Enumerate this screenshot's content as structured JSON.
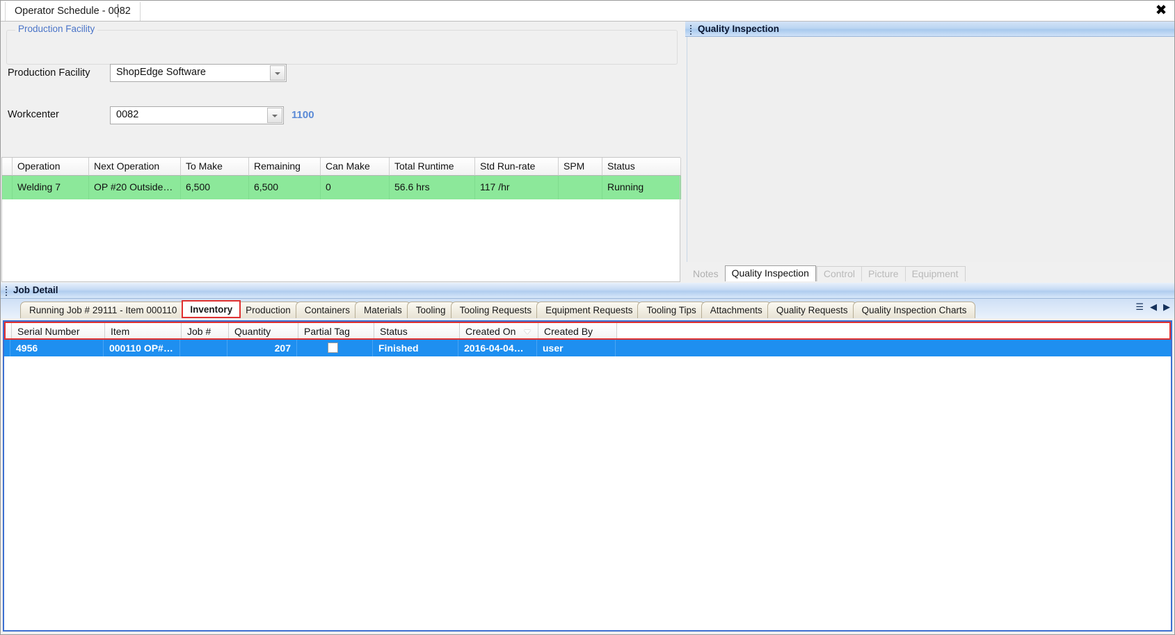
{
  "window": {
    "mdi_tab_label": "Operator Schedule - 0082",
    "close_label": "✖"
  },
  "form": {
    "groupbox_title": "Production Facility",
    "production_facility_label": "Production Facility",
    "production_facility_value": "ShopEdge Software",
    "workcenter_label": "Workcenter",
    "workcenter_value": "0082",
    "workcenter_code": "1100"
  },
  "operations_grid": {
    "columns": [
      "Operation",
      "Next Operation",
      "To Make",
      "Remaining",
      "Can Make",
      "Total Runtime",
      "Std Run-rate",
      "SPM",
      "Status"
    ],
    "rows": [
      {
        "operation": "Welding 7",
        "next_operation": "OP  #20  Outside…",
        "to_make": "6,500",
        "remaining": "6,500",
        "can_make": "0",
        "total_runtime": "56.6 hrs",
        "std_run_rate": "117 /hr",
        "spm": "",
        "status": "Running"
      }
    ],
    "row_highlight_color": "#8ce89a",
    "scroll_left_arrow": "‹",
    "scroll_right_arrow": "›"
  },
  "quality_panel": {
    "title": "Quality Inspection",
    "tabs": [
      {
        "label": "Notes",
        "state": "muted"
      },
      {
        "label": "Quality Inspection",
        "state": "active"
      },
      {
        "label": "Control",
        "state": "dim"
      },
      {
        "label": "Picture",
        "state": "dim"
      },
      {
        "label": "Equipment",
        "state": "dim"
      }
    ]
  },
  "job_detail": {
    "title": "Job Detail",
    "tabs": [
      {
        "label": "Running Job # 29111 - Item 000110",
        "active": false
      },
      {
        "label": "Inventory",
        "active": true
      },
      {
        "label": "Production",
        "active": false
      },
      {
        "label": "Containers",
        "active": false
      },
      {
        "label": "Materials",
        "active": false
      },
      {
        "label": "Tooling",
        "active": false
      },
      {
        "label": "Tooling Requests",
        "active": false
      },
      {
        "label": "Equipment Requests",
        "active": false
      },
      {
        "label": "Tooling Tips",
        "active": false
      },
      {
        "label": "Attachments",
        "active": false
      },
      {
        "label": "Quality Requests",
        "active": false
      },
      {
        "label": "Quality Inspection Charts",
        "active": false
      }
    ],
    "tab_nav": {
      "menu": "☰",
      "prev": "◀",
      "next": "▶"
    },
    "active_tab_outline_color": "#e03030"
  },
  "inventory_grid": {
    "columns": [
      "Serial Number",
      "Item",
      "Job #",
      "Quantity",
      "Partial Tag",
      "Status",
      "Created On",
      "Created By"
    ],
    "sort_column": "Created On",
    "sort_direction": "descending",
    "rows": [
      {
        "serial_number": "4956",
        "item": "000110 OP#…",
        "job_number": "",
        "quantity": "207",
        "partial_tag": "",
        "status": "Finished",
        "created_on": "2016-04-04…",
        "created_by": "user"
      }
    ],
    "selected_row_color": "#1e8ff0"
  }
}
